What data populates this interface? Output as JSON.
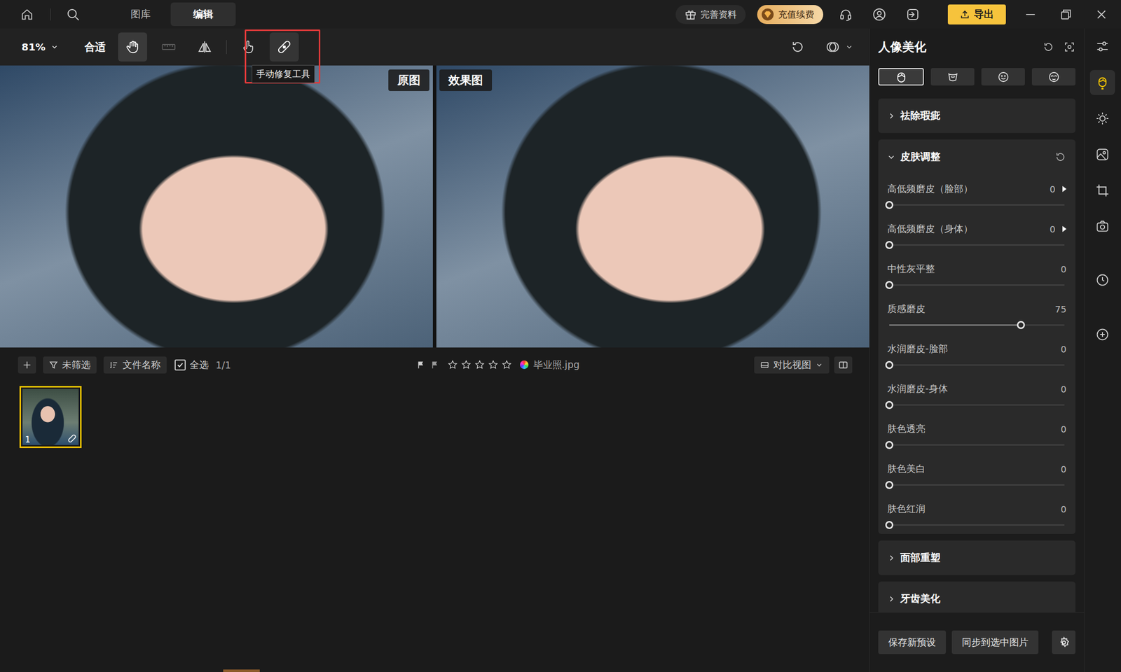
{
  "top_bar": {
    "tabs": [
      {
        "label": "图库",
        "selected": false
      },
      {
        "label": "编辑",
        "selected": true
      }
    ],
    "profile_button": "完善资料",
    "recharge_button": "充值续费",
    "export_button": "导出"
  },
  "toolbar": {
    "zoom": "81%",
    "fit_button": "合适",
    "tools": [
      {
        "kind": "hand",
        "selected": true,
        "disabled": false,
        "hovered": false
      },
      {
        "kind": "ruler",
        "selected": false,
        "disabled": true,
        "hovered": false
      },
      {
        "kind": "flip",
        "selected": false,
        "disabled": false,
        "hovered": false
      },
      {
        "kind": "finger",
        "selected": false,
        "disabled": false,
        "hovered": false
      },
      {
        "kind": "bandage",
        "selected": false,
        "disabled": false,
        "hovered": true
      }
    ],
    "tooltip": "手动修复工具"
  },
  "canvas": {
    "panes": [
      {
        "label": "原图"
      },
      {
        "label": "效果图"
      }
    ]
  },
  "filmstrip": {
    "filter_button": "未筛选",
    "sort_button": "文件名称",
    "select_all": {
      "label": "全选",
      "checked": true
    },
    "count": "1/1",
    "stars": 0,
    "max_stars": 5,
    "file_name": "毕业照.jpg",
    "view_mode": "对比视图",
    "thumbnails": [
      {
        "index": "1",
        "selected": true
      }
    ]
  },
  "panel": {
    "title": "人像美化",
    "tabs": [
      {
        "kind": "portrait",
        "selected": true
      },
      {
        "kind": "body",
        "selected": false
      },
      {
        "kind": "smile",
        "selected": false
      },
      {
        "kind": "mask",
        "selected": false
      }
    ],
    "sections": [
      {
        "title": "祛除瑕疵",
        "expanded": false,
        "sliders": []
      },
      {
        "title": "皮肤调整",
        "expanded": true,
        "sliders": [
          {
            "label": "高低频磨皮（脸部）",
            "value": "0",
            "level": 0,
            "has_submenu": true
          },
          {
            "label": "高低频磨皮（身体）",
            "value": "0",
            "level": 0,
            "has_submenu": true
          },
          {
            "label": "中性灰平整",
            "value": "0",
            "level": 0,
            "has_submenu": false
          },
          {
            "label": "质感磨皮",
            "value": "75",
            "level": 0.75,
            "has_submenu": false
          },
          {
            "label": "水润磨皮-脸部",
            "value": "0",
            "level": 0,
            "has_submenu": false
          },
          {
            "label": "水润磨皮-身体",
            "value": "0",
            "level": 0,
            "has_submenu": false
          },
          {
            "label": "肤色透亮",
            "value": "0",
            "level": 0,
            "has_submenu": false
          },
          {
            "label": "肤色美白",
            "value": "0",
            "level": 0,
            "has_submenu": false
          },
          {
            "label": "肤色红润",
            "value": "0",
            "level": 0,
            "has_submenu": false
          }
        ]
      },
      {
        "title": "面部重塑",
        "expanded": false,
        "sliders": []
      },
      {
        "title": "牙齿美化",
        "expanded": false,
        "sliders": []
      }
    ],
    "footer_buttons": [
      "保存新预设",
      "同步到选中图片"
    ]
  },
  "rail": {
    "items": [
      {
        "kind": "adjust",
        "selected": false
      },
      {
        "kind": "portrait",
        "selected": true
      },
      {
        "kind": "light",
        "selected": false
      },
      {
        "kind": "image",
        "selected": false
      },
      {
        "kind": "crop",
        "selected": false
      },
      {
        "kind": "camera",
        "selected": false
      },
      {
        "kind": "history",
        "selected": false
      },
      {
        "kind": "add",
        "selected": false
      }
    ]
  }
}
